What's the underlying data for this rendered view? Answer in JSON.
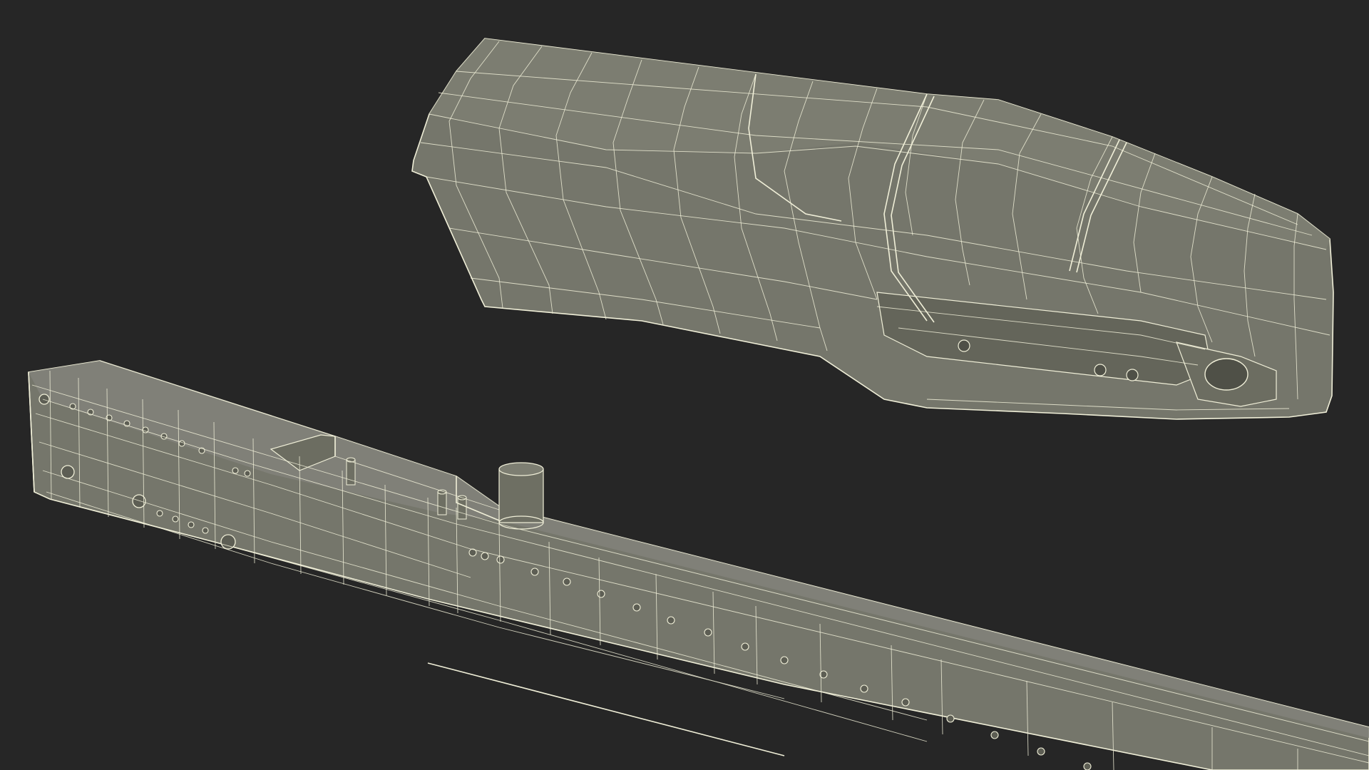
{
  "scene": {
    "background": "#262626",
    "surface_color": "#75766b",
    "surface_dark": "#666759",
    "surface_light": "#858679",
    "wire_color": "#f0efd8",
    "objects": [
      {
        "name": "upper-housing",
        "kind": "wireframe-mesh"
      },
      {
        "name": "lower-rail",
        "kind": "wireframe-mesh"
      }
    ]
  }
}
